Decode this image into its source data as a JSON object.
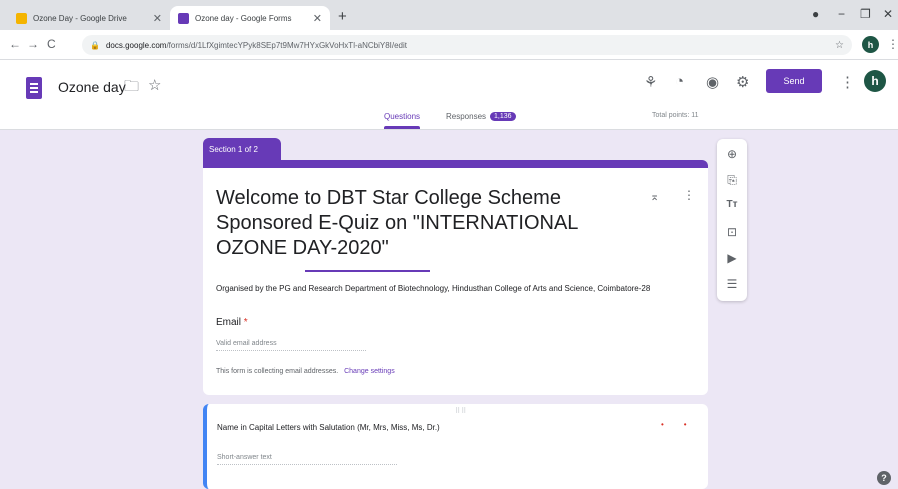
{
  "browser": {
    "tabs": [
      {
        "label": "Ozone Day - Google Drive",
        "close": "✕",
        "favicon_color": "#f4b400"
      },
      {
        "label": "Ozone day - Google Forms",
        "close": "✕",
        "favicon_color": "#673ab7"
      }
    ],
    "new_tab": "+",
    "url_host": "docs.google.com",
    "url_path": "/forms/d/1LfXgimtecYPyk8SEp7t9Mw7HYxGkVoHxTl-aNCbiY8I/edit",
    "profile_initial": "h"
  },
  "header": {
    "title": "Ozone day",
    "send_label": "Send",
    "profile_initial": "h",
    "tabs": {
      "questions": "Questions",
      "responses": "Responses",
      "responses_count": "1,136"
    },
    "total_points": "Total points: 11"
  },
  "section": {
    "label": "Section 1 of 2",
    "title": "Welcome to DBT Star College Scheme Sponsored  E-Quiz on \"INTERNATIONAL OZONE DAY-2020\"",
    "description": "Organised by the PG and Research Department of Biotechnology, Hindusthan College of Arts and Science, Coimbatore-28",
    "email_label": "Email",
    "required_mark": "*",
    "email_placeholder": "Valid email address",
    "collecting_note": "This form is collecting email addresses.",
    "change_settings": "Change settings"
  },
  "question": {
    "title": "Name in Capital Letters with Salutation (Mr, Mrs, Miss, Ms, Dr.)",
    "placeholder": "Short-answer text"
  },
  "colors": {
    "accent": "#673ab7",
    "active_border": "#4285f4",
    "background": "#ece7f5"
  }
}
